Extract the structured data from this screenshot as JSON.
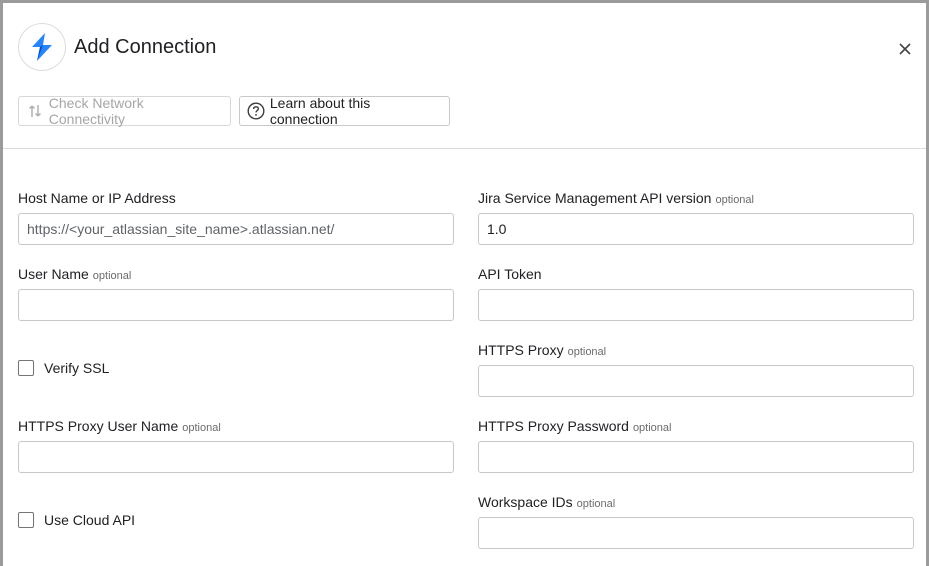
{
  "dialog": {
    "title": "Add Connection",
    "logo_icon": "jira-service-management-logo",
    "close_icon": "close-icon"
  },
  "toolbar": {
    "check_network_label": "Check Network Connectivity",
    "learn_label": "Learn about this connection"
  },
  "optional_text": "optional",
  "fields": {
    "host": {
      "label": "Host Name or IP Address",
      "placeholder": "https://<your_atlassian_site_name>.atlassian.net/",
      "value": ""
    },
    "api_version": {
      "label": "Jira Service Management API version",
      "value": "1.0"
    },
    "user_name": {
      "label": "User Name",
      "value": ""
    },
    "api_token": {
      "label": "API Token",
      "value": ""
    },
    "verify_ssl": {
      "label": "Verify SSL",
      "checked": false
    },
    "https_proxy": {
      "label": "HTTPS Proxy",
      "value": ""
    },
    "proxy_user": {
      "label": "HTTPS Proxy User Name",
      "value": ""
    },
    "proxy_password": {
      "label": "HTTPS Proxy Password",
      "value": ""
    },
    "use_cloud_api": {
      "label": "Use Cloud API",
      "checked": false
    },
    "workspace_ids": {
      "label": "Workspace IDs",
      "value": ""
    }
  },
  "colors": {
    "brand_blue": "#2684FF",
    "brand_blue_dark": "#0052CC"
  }
}
